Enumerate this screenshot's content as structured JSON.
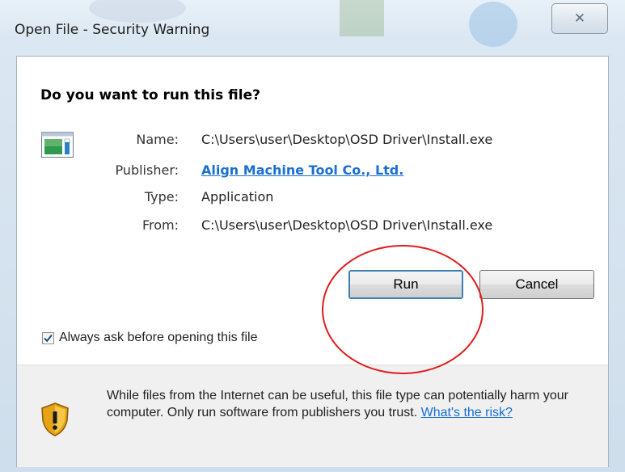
{
  "window": {
    "title": "Open File - Security Warning",
    "close_glyph": "✕"
  },
  "dialog": {
    "heading": "Do you want to run this file?",
    "file_icon": "application-file-icon",
    "fields": {
      "name_label": "Name:",
      "name_value": "C:\\Users\\user\\Desktop\\OSD Driver\\Install.exe",
      "publisher_label": "Publisher:",
      "publisher_value": "Align Machine Tool Co., Ltd.",
      "type_label": "Type:",
      "type_value": "Application",
      "from_label": "From:",
      "from_value": "C:\\Users\\user\\Desktop\\OSD Driver\\Install.exe"
    },
    "buttons": {
      "run": "Run",
      "cancel": "Cancel"
    },
    "checkbox": {
      "label": "Always ask before opening this file",
      "checked": true
    },
    "warning": {
      "icon": "warning-shield-icon",
      "text": "While files from the Internet can be useful, this file type can potentially harm your computer. Only run software from publishers you trust.",
      "link": "What's the risk?"
    }
  },
  "annotation": {
    "color": "#e01b1b"
  },
  "colors": {
    "link": "#1a6fd0",
    "frame": "#cfdeec"
  }
}
